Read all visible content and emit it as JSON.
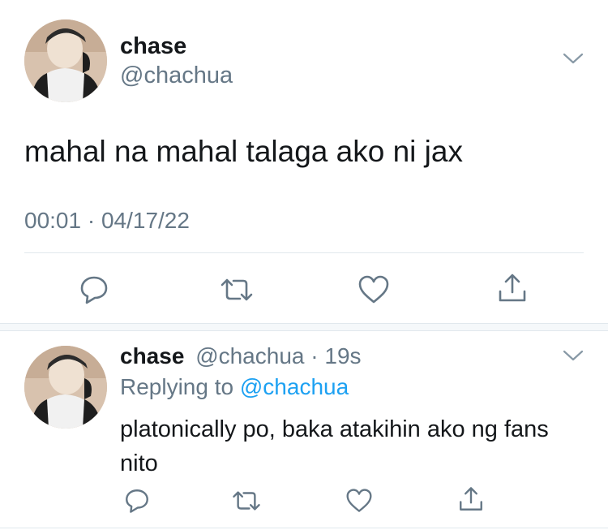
{
  "main_tweet": {
    "author_name": "chase",
    "author_handle": "@chachua",
    "text": "mahal na mahal talaga ako ni jax",
    "timestamp": "00:01 · 04/17/22"
  },
  "reply_tweet": {
    "author_name": "chase",
    "author_handle": "@chachua",
    "separator": "·",
    "age": "19s",
    "replying_prefix": "Replying to",
    "replying_handle": "@chachua",
    "text": "platonically po, baka atakihin ako ng fans nito"
  },
  "icons": [
    "chevron-down-icon",
    "reply-icon",
    "retweet-icon",
    "like-icon",
    "share-icon"
  ],
  "colors": {
    "text": "#14171a",
    "muted": "#657786",
    "link": "#1da1f2",
    "divider": "#e1e8ed"
  }
}
